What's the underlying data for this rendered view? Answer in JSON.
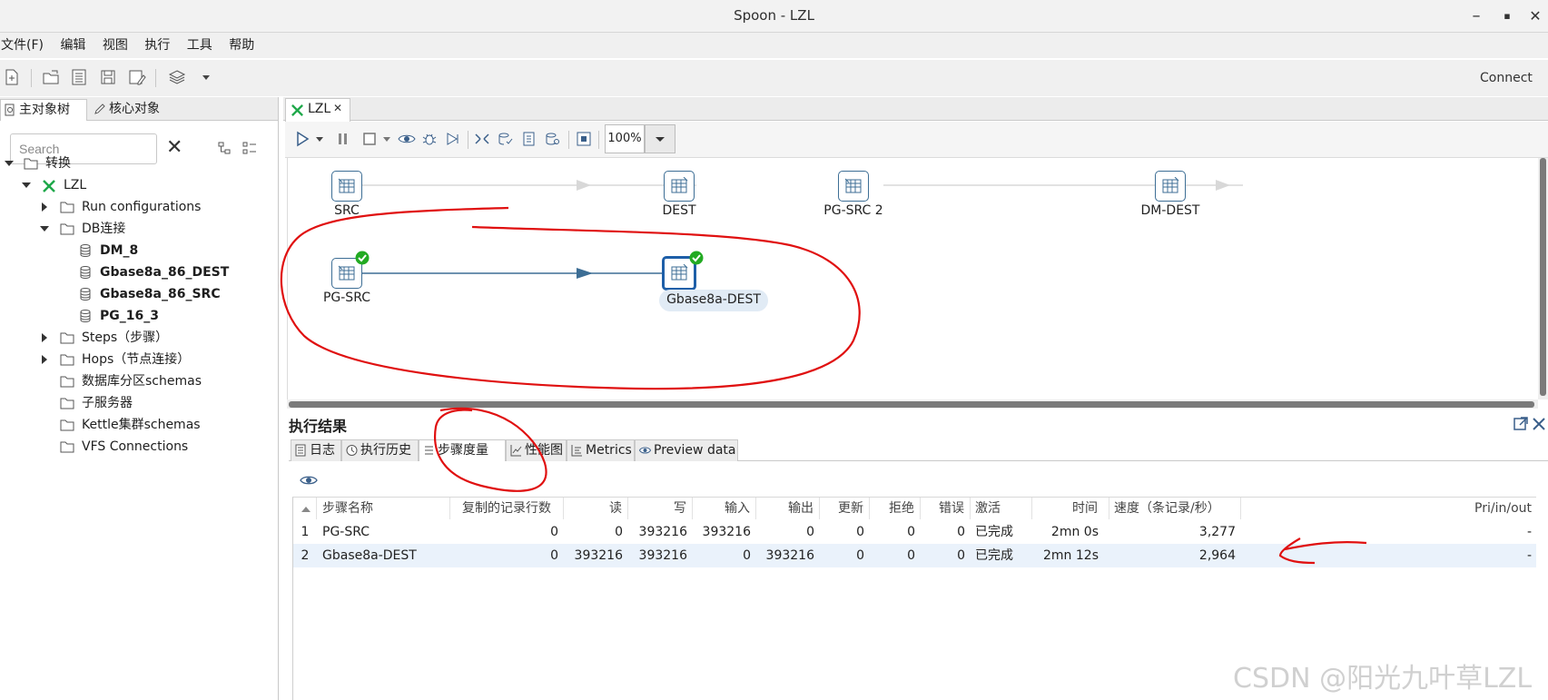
{
  "window": {
    "title": "Spoon - LZL",
    "controls": {
      "minimize": "–",
      "maximize": "▪",
      "close": "✕"
    }
  },
  "menu": [
    "文件(F)",
    "编辑",
    "视图",
    "执行",
    "工具",
    "帮助"
  ],
  "toolbar": {
    "connect_label": "Connect"
  },
  "left_panel": {
    "tabs": [
      "主对象树",
      "核心对象"
    ],
    "search_placeholder": "Search",
    "clear": "✕",
    "tree": {
      "root": "转换",
      "transformation": "LZL",
      "run_configurations": "Run configurations",
      "db_connections": "DB连接",
      "connections": [
        "DM_8",
        "Gbase8a_86_DEST",
        "Gbase8a_86_SRC",
        "PG_16_3"
      ],
      "steps": "Steps（步骤）",
      "hops": "Hops（节点连接）",
      "partition_schemas": "数据库分区schemas",
      "slave_servers": "子服务器",
      "cluster_schemas": "Kettle集群schemas",
      "vfs": "VFS Connections"
    }
  },
  "editor": {
    "tab_label": "LZL",
    "tab_close": "✕",
    "zoom": "100%",
    "steps": [
      "SRC",
      "DEST",
      "PG-SRC 2",
      "DM-DEST",
      "PG-SRC",
      "Gbase8a-DEST"
    ]
  },
  "results": {
    "title": "执行结果",
    "tabs": [
      "日志",
      "执行历史",
      "步骤度量",
      "性能图",
      "Metrics",
      "Preview data"
    ],
    "active_tab": "步骤度量",
    "columns": [
      "步骤名称",
      "复制的记录行数",
      "读",
      "写",
      "输入",
      "输出",
      "更新",
      "拒绝",
      "错误",
      "激活",
      "时间",
      "速度（条记录/秒）",
      "Pri/in/out"
    ],
    "rows": [
      [
        "1",
        "PG-SRC",
        "0",
        "0",
        "393216",
        "393216",
        "0",
        "0",
        "0",
        "0",
        "已完成",
        "2mn 0s",
        "3,277",
        "-"
      ],
      [
        "2",
        "Gbase8a-DEST",
        "0",
        "393216",
        "393216",
        "0",
        "393216",
        "0",
        "0",
        "0",
        "已完成",
        "2mn 12s",
        "2,964",
        "-"
      ]
    ]
  },
  "watermark": "CSDN @阳光九叶草LZL",
  "colors": {
    "accent_blue": "#1e5fa8",
    "success_green": "#22aa22",
    "annotation_red": "#e01010",
    "hop_line": "#3d6e95"
  }
}
